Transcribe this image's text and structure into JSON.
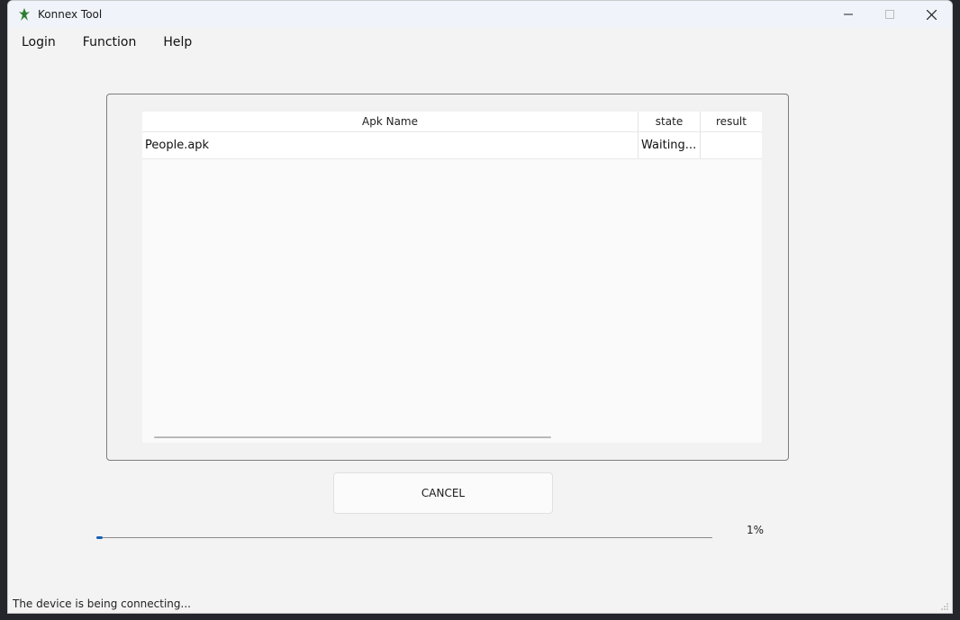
{
  "window": {
    "title": "Konnex Tool",
    "app_icon": "konnex-logo-icon",
    "controls": [
      "minimize-icon",
      "maximize-icon",
      "close-icon"
    ]
  },
  "menu": {
    "items": [
      {
        "label": "Login"
      },
      {
        "label": "Function"
      },
      {
        "label": "Help"
      }
    ]
  },
  "table": {
    "headers": [
      "Apk Name",
      "state",
      "result"
    ],
    "rows": [
      {
        "name": "People.apk",
        "state": "Waiting...",
        "result": ""
      }
    ]
  },
  "actions": {
    "cancel_label": "CANCEL"
  },
  "progress": {
    "value": 1,
    "label": "1%",
    "color": "#1a5fb4"
  },
  "status_bar": {
    "text": "The device is being connecting..."
  }
}
